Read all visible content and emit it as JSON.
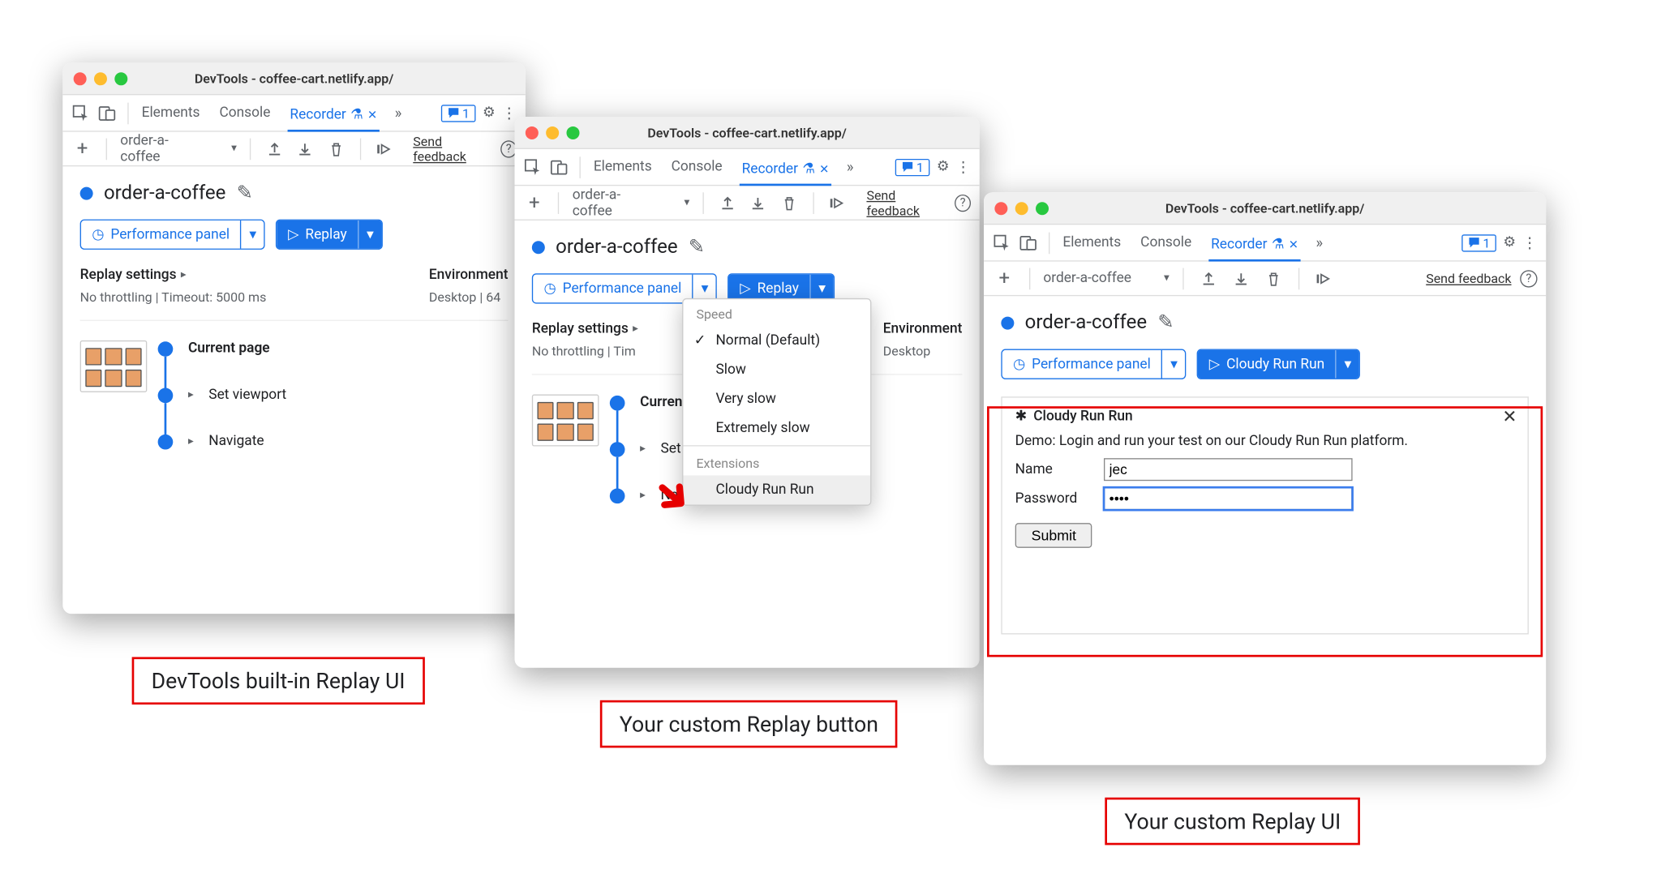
{
  "window_title": "DevTools - coffee-cart.netlify.app/",
  "devtools_tabs": {
    "elements": "Elements",
    "console": "Console",
    "recorder": "Recorder"
  },
  "issues_count": "1",
  "recording_select": "order-a-coffee",
  "send_feedback": "Send feedback",
  "recording_title": "order-a-coffee",
  "perf_panel_btn": "Performance panel",
  "replay_btn": "Replay",
  "custom_replay_btn": "Cloudy Run Run",
  "settings": {
    "replay_head": "Replay settings",
    "replay_sub_full": "No throttling | Timeout: 5000 ms",
    "replay_sub_short_a": "No throttling",
    "replay_sub_short_b": "Tim",
    "env_head": "Environment",
    "env_sub_full": "Desktop | 64",
    "env_sub_short": "Desktop"
  },
  "steps": {
    "current": "Current page",
    "viewport": "Set viewport",
    "navigate": "Navigate"
  },
  "dropdown": {
    "speed_label": "Speed",
    "items": [
      "Normal (Default)",
      "Slow",
      "Very slow",
      "Extremely slow"
    ],
    "ext_label": "Extensions",
    "ext_item": "Cloudy Run Run"
  },
  "panel3": {
    "title": "Cloudy Run Run",
    "desc": "Demo: Login and run your test on our Cloudy Run Run platform.",
    "name_label": "Name",
    "name_value": "jec",
    "pwd_label": "Password",
    "pwd_value": "••••",
    "submit": "Submit"
  },
  "captions": {
    "c1": "DevTools built-in Replay UI",
    "c2": "Your custom Replay button",
    "c3": "Your custom Replay UI"
  }
}
